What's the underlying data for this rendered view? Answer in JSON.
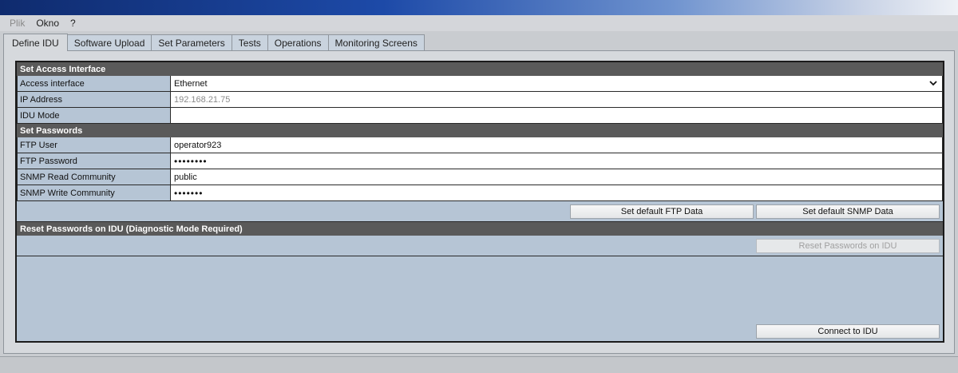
{
  "menu": {
    "items": [
      "Plik",
      "Okno",
      "?"
    ]
  },
  "tabs": [
    "Define IDU",
    "Software Upload",
    "Set Parameters",
    "Tests",
    "Operations",
    "Monitoring Screens"
  ],
  "sections": {
    "access": "Set Access Interface",
    "passwords": "Set Passwords",
    "reset": "Reset Passwords on IDU (Diagnostic Mode Required)"
  },
  "access": {
    "interface_label": "Access interface",
    "interface_value": "Ethernet",
    "ip_label": "IP Address",
    "ip_value": "192.168.21.75",
    "mode_label": "IDU Mode",
    "mode_value": ""
  },
  "passwords": {
    "ftp_user_label": "FTP User",
    "ftp_user_value": "operator923",
    "ftp_password_label": "FTP Password",
    "ftp_password_value": "••••••••",
    "snmp_read_label": "SNMP Read Community",
    "snmp_read_value": "public",
    "snmp_write_label": "SNMP Write Community",
    "snmp_write_value": "•••••••"
  },
  "buttons": {
    "default_ftp": "Set default FTP Data",
    "default_snmp": "Set default SNMP Data",
    "reset_passwords": "Reset Passwords on IDU",
    "connect": "Connect to IDU"
  }
}
